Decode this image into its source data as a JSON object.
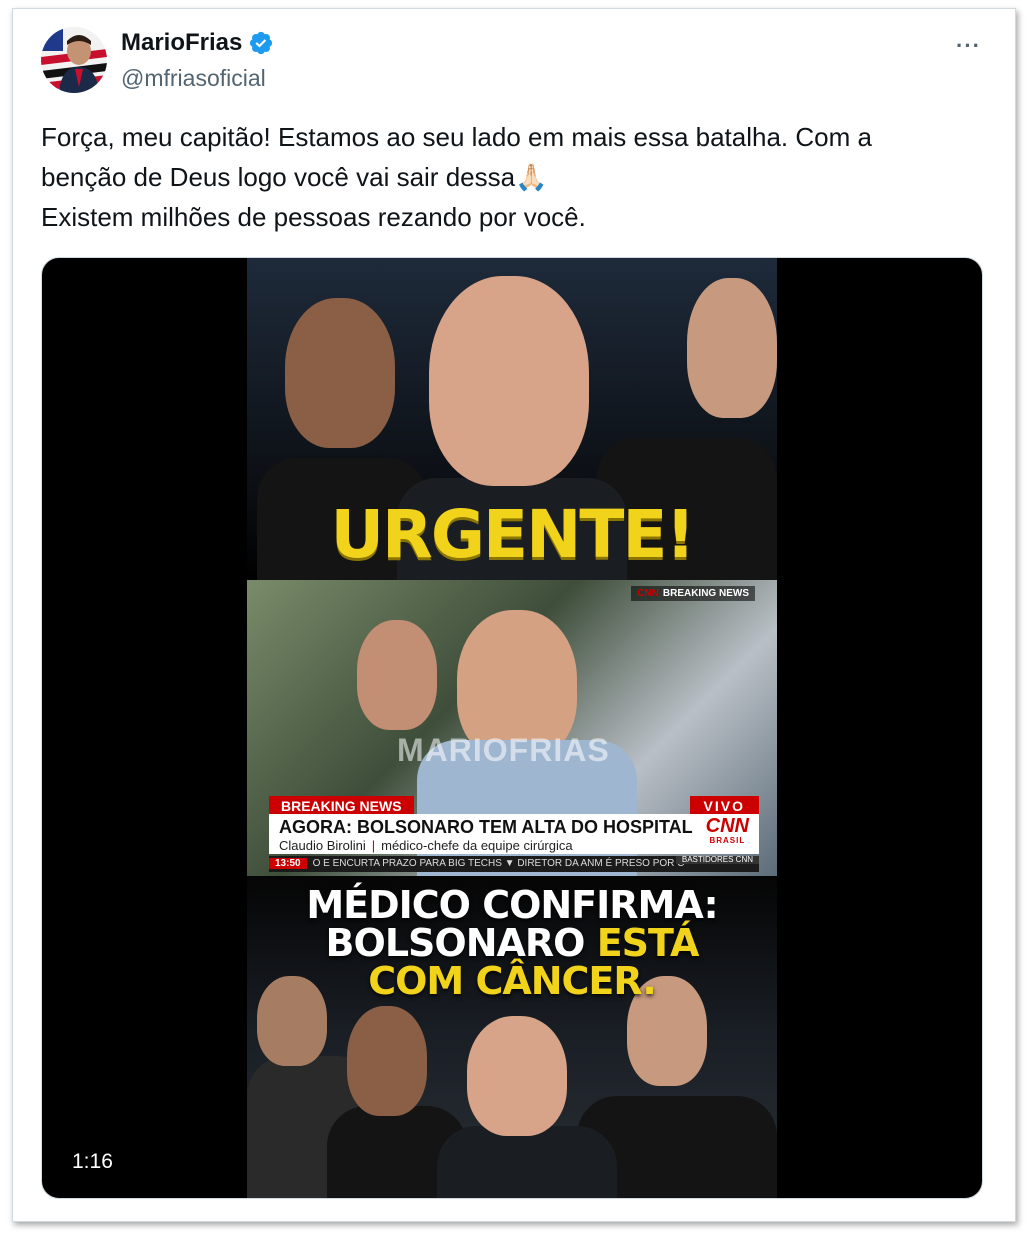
{
  "author": {
    "display_name": "MarioFrias",
    "handle": "@mfriasoficial",
    "verified_icon": "verified-badge-icon",
    "verified_color": "#1d9bf0"
  },
  "more_icon": "···",
  "tweet": {
    "lines": [
      "Força, meu capitão! Estamos ao seu lado em mais essa batalha. Com a",
      "benção de Deus logo você vai sair dessa🙏🏻",
      "Existem milhões de pessoas rezando por você."
    ]
  },
  "video": {
    "duration": "1:16",
    "urgente": "URGENTE!",
    "cnn_top_badge": "BREAKING NEWS",
    "cnn_top_logo": "CNN",
    "watermark": "MARIOFRIAS",
    "breaking_label": "BREAKING NEWS",
    "live_label": "VIVO",
    "headline": "AGORA: BOLSONARO TEM ALTA DO HOSPITAL",
    "subline_name": "Claudio Birolini",
    "subline_sep": "|",
    "subline_role": "médico-chefe da equipe cirúrgica",
    "cnn_logo": "CNN",
    "cnn_logo_sub": "BRASIL",
    "ticker_time": "13:50",
    "ticker_text": "O E ENCURTA PRAZO PARA BIG TECHS  ▼ DIRETOR DA ANM É PRESO POR C",
    "ticker_tag": "BASTIDORES CNN",
    "medico_line1": "MÉDICO CONFIRMA:",
    "medico_line2_white": "BOLSONARO ",
    "medico_line2_yellow": "ESTÁ",
    "medico_line3_yellow": "COM CÂNCER."
  },
  "colors": {
    "accent_yellow": "#f2d31b",
    "cnn_red": "#cc0000"
  }
}
